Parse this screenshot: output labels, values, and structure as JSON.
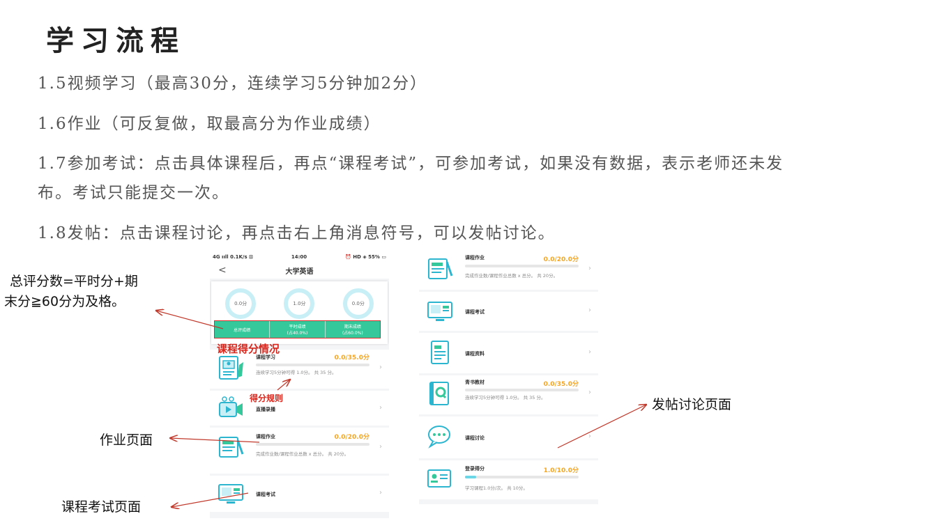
{
  "slide": {
    "title": "学习流程",
    "paragraphs": [
      "1.5视频学习（最高30分，连续学习5分钟加2分）",
      "1.6作业（可反复做，取最高分为作业成绩）",
      "1.7参加考试：点击具体课程后，再点“课程考试”，可参加考试，如果没有数据，表示老师还未发",
      "布。考试只能提交一次。",
      "1.8发帖：点击课程讨论，再点击右上角消息符号，可以发帖讨论。"
    ]
  },
  "annotations": {
    "total_score_line1": "总评分数=平时分+期",
    "total_score_line2": "末分≧60分为及格。",
    "score_situation": "课程得分情况",
    "score_rules": "得分规则",
    "homework_page": "作业页面",
    "exam_page": "课程考试页面",
    "discussion_page": "发帖讨论页面"
  },
  "phone_left": {
    "status_left": "4G ııll  0.1K/s ⊡",
    "status_time": "14:00",
    "status_right": "⏰ HD ◈ 55% ▭",
    "back_icon": "chevron-left-icon",
    "title": "大学英语",
    "rings": [
      "0.0分",
      "1.0分",
      "0.0分"
    ],
    "tabs": [
      {
        "line1": "总评成绩",
        "line2": ""
      },
      {
        "line1": "平时成绩",
        "line2": "(占40.0%)"
      },
      {
        "line1": "期末成绩",
        "line2": "(占60.0%)"
      }
    ],
    "items": [
      {
        "name": "课程学习",
        "score": "0.0/35.0分",
        "desc": "连续学习5分钟可得 1.0分。 共 35 分。",
        "progress": 0
      },
      {
        "name": "直播录播",
        "score": "",
        "desc": "",
        "progress": null
      },
      {
        "name": "课程作业",
        "score": "0.0/20.0分",
        "desc": "完成作业数/课程作业总数 x 总分。 共 20分。",
        "progress": 0
      },
      {
        "name": "课程考试",
        "score": "",
        "desc": "",
        "progress": null
      }
    ]
  },
  "phone_right": {
    "items": [
      {
        "name": "课程作业",
        "score": "0.0/20.0分",
        "desc": "完成作业数/课程作业总数 x 总分。 共 20分。",
        "progress": 0
      },
      {
        "name": "课程考试",
        "score": "",
        "desc": "",
        "progress": null
      },
      {
        "name": "课程资料",
        "score": "",
        "desc": "",
        "progress": null
      },
      {
        "name": "青书教材",
        "score": "0.0/35.0分",
        "desc": "连续学习5分钟可得 1.0分。 共 35 分。",
        "progress": 0
      },
      {
        "name": "课程讨论",
        "score": "",
        "desc": "",
        "progress": null
      },
      {
        "name": "登录得分",
        "score": "1.0/10.0分",
        "desc": "学习课程1.0分/次。 共 10分。",
        "progress": 0.1
      }
    ]
  },
  "colors": {
    "accent_green": "#35c89a",
    "score_orange": "#f5a623",
    "annotation_red": "#d9261c"
  }
}
